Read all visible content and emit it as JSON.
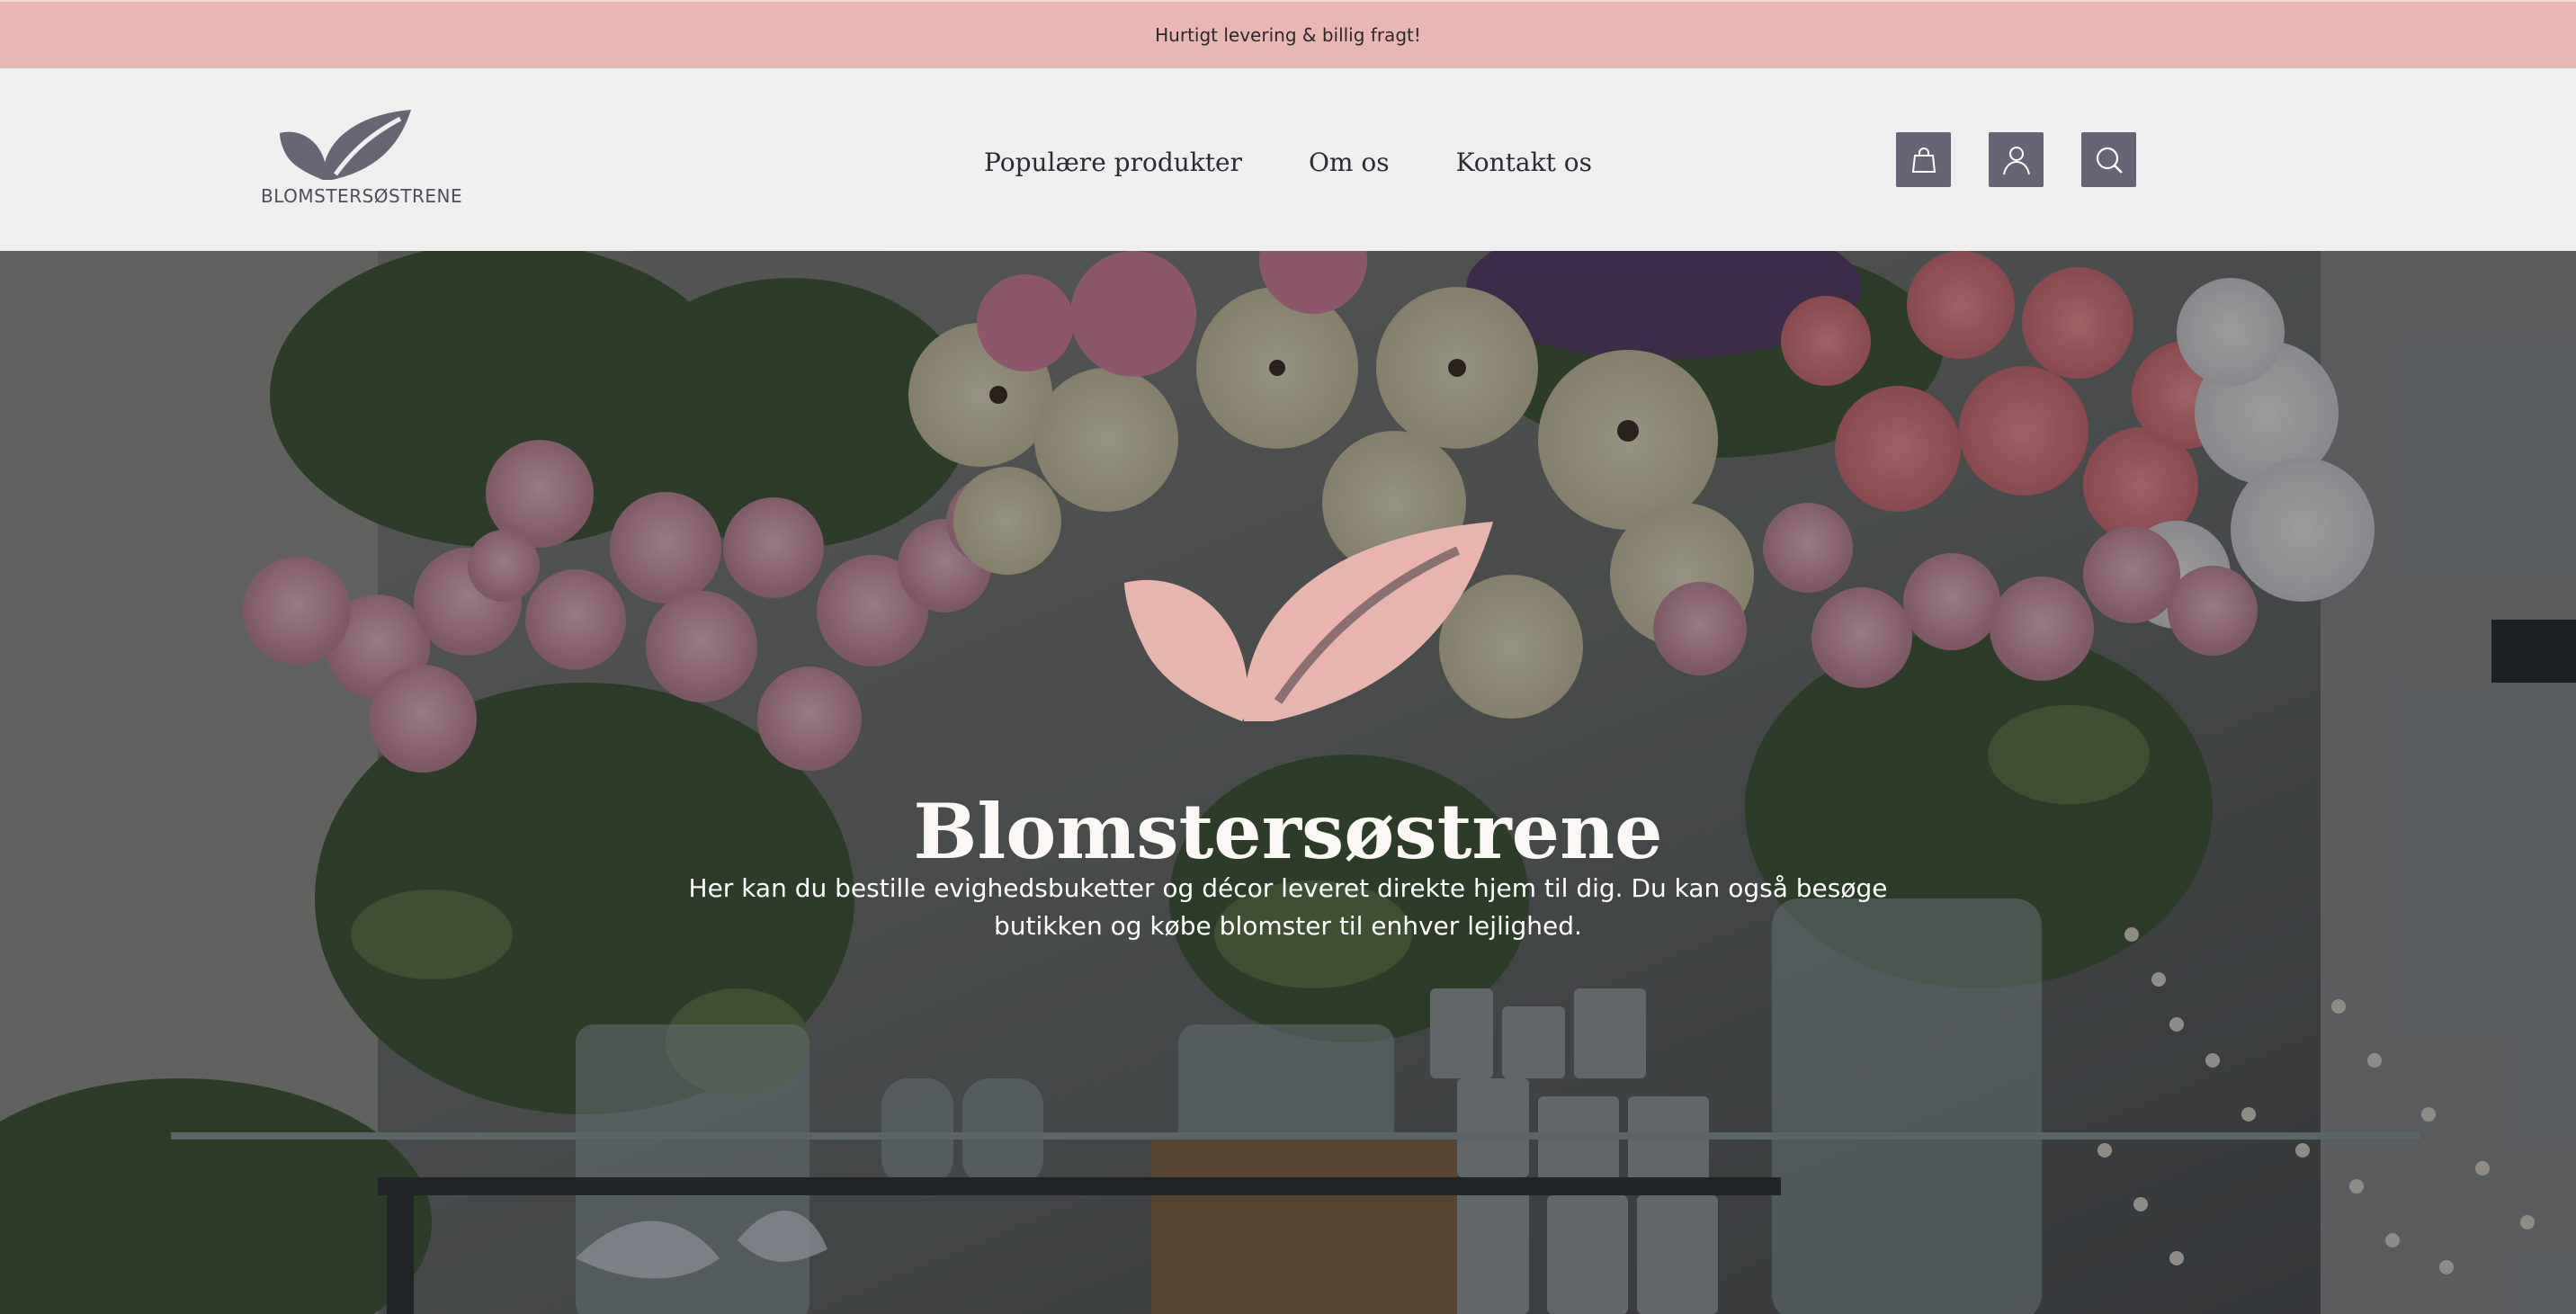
{
  "announcement": {
    "text": "Hurtigt levering & billig fragt!"
  },
  "brand": {
    "name": "BLOMSTERSØSTRENE",
    "logo_color": "#666675",
    "hero_logo_color": "#e8b4ae"
  },
  "nav": {
    "items": [
      {
        "label": "Populære produkter"
      },
      {
        "label": "Om os"
      },
      {
        "label": "Kontakt os"
      }
    ]
  },
  "actions": {
    "icons": [
      "shopping-bag-icon",
      "user-icon",
      "search-icon"
    ],
    "button_color": "#656575"
  },
  "hero": {
    "title": "Blomstersøstrene",
    "subtitle": "Her kan du bestille evighedsbuketter og décor leveret direkte hjem til dig. Du kan også besøge butikken og købe blomster til enhver lejlighed."
  },
  "colors": {
    "announcement_bg": "#e8b7b3",
    "header_bg": "#efefef"
  }
}
